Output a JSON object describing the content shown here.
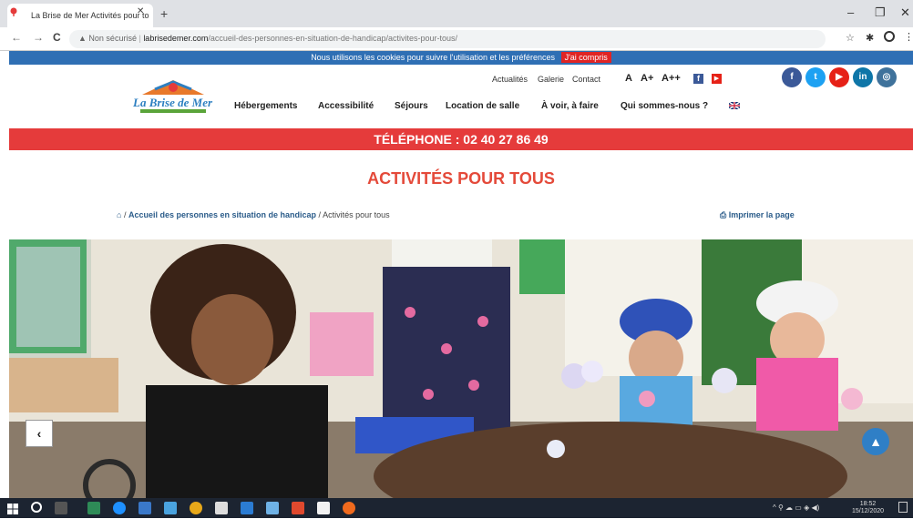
{
  "browser": {
    "tab_title": "La Brise de Mer Activités pour to",
    "tab_close": "✕",
    "new_tab": "+",
    "window_controls": [
      "–",
      "❐",
      "✕"
    ],
    "nav": {
      "back": "←",
      "forward": "→",
      "reload": "C"
    },
    "security_label": "Non sécurisé",
    "url_host": "labrisedemer.com",
    "url_path": "/accueil-des-personnes-en-situation-de-handicap/activites-pour-tous/"
  },
  "cookie_banner": {
    "text": "Nous utilisons les cookies pour suivre l'utilisation et les préférences",
    "accept": "J'ai compris"
  },
  "header": {
    "logo_text": "La Brise de Mer",
    "top_links": [
      "Actualités",
      "Galerie",
      "Contact"
    ],
    "font_sizes": [
      "A",
      "A+",
      "A++"
    ],
    "nav": [
      "Hébergements",
      "Accessibilité",
      "Séjours",
      "Location de salle",
      "À voir, à faire",
      "Qui sommes-nous ?"
    ],
    "social": [
      {
        "name": "facebook",
        "glyph": "f",
        "color": "#3b5998"
      },
      {
        "name": "twitter",
        "glyph": "t",
        "color": "#1da1f2"
      },
      {
        "name": "youtube",
        "glyph": "▶",
        "color": "#e62117"
      },
      {
        "name": "linkedin",
        "glyph": "in",
        "color": "#0e76a8"
      },
      {
        "name": "instagram",
        "glyph": "◎",
        "color": "#3f729b"
      }
    ]
  },
  "phone": "TÉLÉPHONE : 02 40 27 86 49",
  "page_title": "ACTIVITÉS POUR TOUS",
  "breadcrumb": {
    "home_icon": "⌂",
    "parent": "Accueil des personnes en situation de handicap",
    "current": "Activités pour tous"
  },
  "print_label": "Imprimer la page",
  "slider": {
    "prev": "‹",
    "scroll_top": "▲"
  },
  "taskbar": {
    "time": "18:52",
    "date": "15/12/2020"
  },
  "colors": {
    "accent_red": "#e53b3b",
    "banner_blue": "#2f6fb4",
    "title_red": "#e44a3a",
    "link_blue": "#2b5c8a"
  }
}
